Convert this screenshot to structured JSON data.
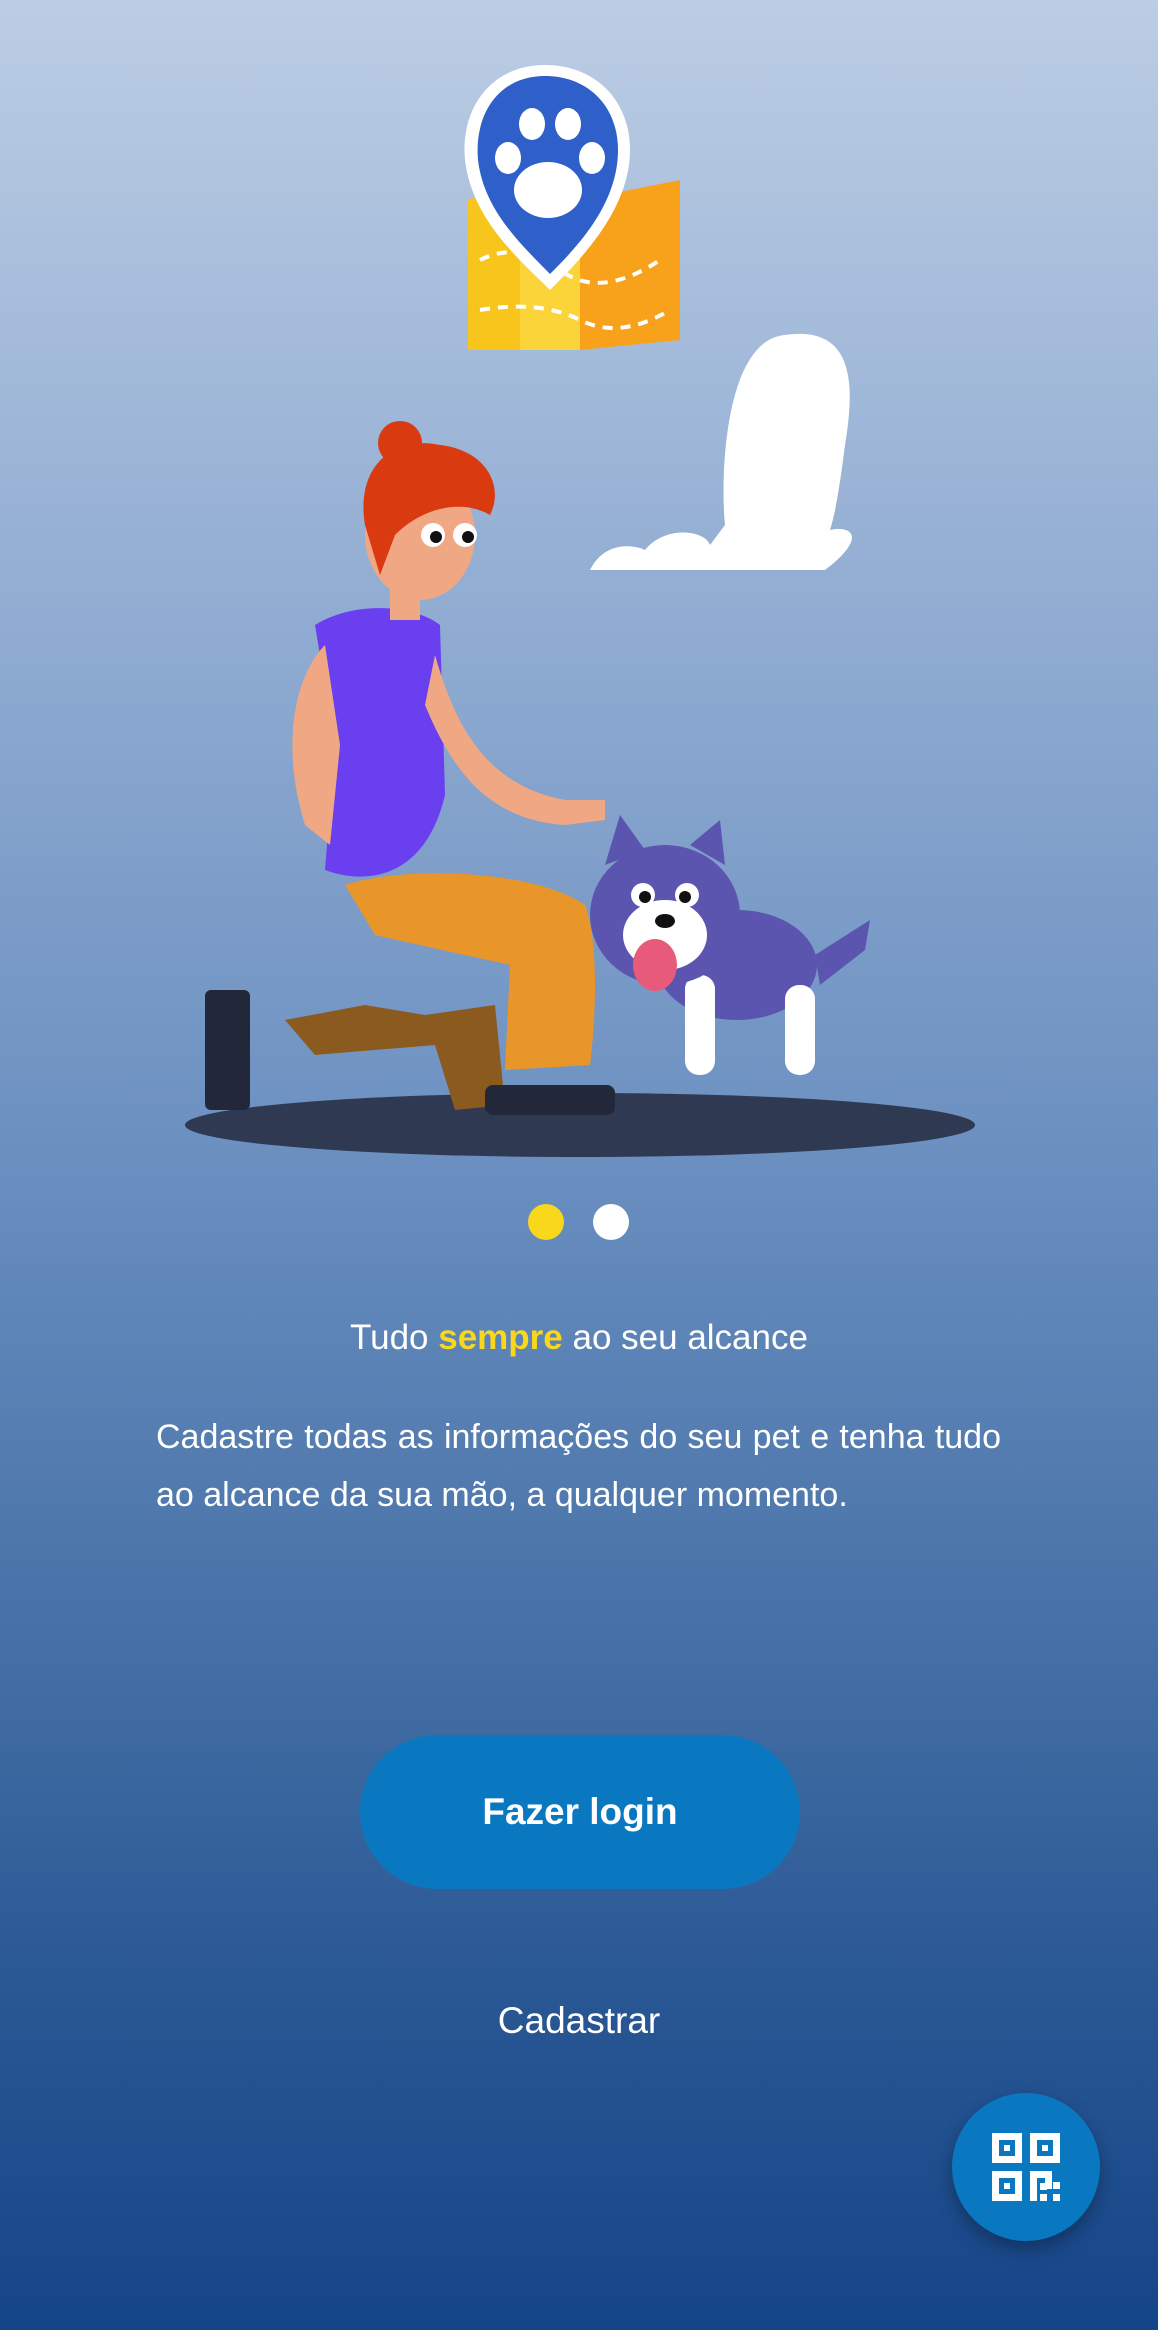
{
  "carousel": {
    "total_pages": 2,
    "active_page": 1,
    "active_color": "#f8d71c",
    "inactive_color": "#ffffff"
  },
  "headline": {
    "before": "Tudo ",
    "highlight": "sempre",
    "after": " ao seu alcance"
  },
  "description": "Cadastre todas as informações do seu pet e tenha tudo ao alcance da sua mão, a qualquer momento.",
  "actions": {
    "login_label": "Fazer login",
    "signup_label": "Cadastrar"
  },
  "fab": {
    "icon": "qr-code-icon"
  },
  "colors": {
    "primary": "#0a78c0",
    "accent": "#f8d71c"
  }
}
